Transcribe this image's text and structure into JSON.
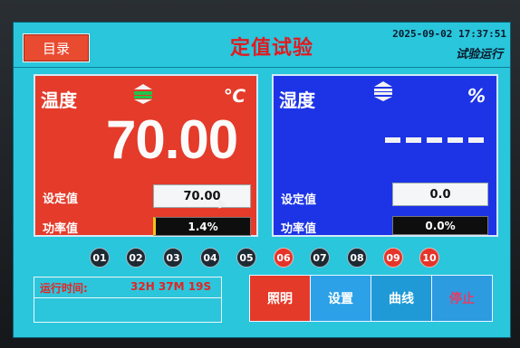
{
  "header": {
    "menu_label": "目录",
    "title": "定值试验",
    "datetime": "2025-09-02 17:37:51",
    "status": "试验运行"
  },
  "temperature": {
    "label": "温度",
    "unit": "℃",
    "value": "70.00",
    "set_label": "设定值",
    "set_value": "70.00",
    "power_label": "功率值",
    "power_value": "1.4%",
    "arrow_colors": {
      "up": "#f2f2f2",
      "mid": "#22c24b",
      "down": "#f2f2f2"
    }
  },
  "humidity": {
    "label": "湿度",
    "unit": "%",
    "value_placeholder": "-----",
    "set_label": "设定值",
    "set_value": "0.0",
    "power_label": "功率值",
    "power_value": "0.0%"
  },
  "channels": [
    {
      "label": "01",
      "state": "off"
    },
    {
      "label": "02",
      "state": "off"
    },
    {
      "label": "03",
      "state": "off"
    },
    {
      "label": "04",
      "state": "off"
    },
    {
      "label": "05",
      "state": "off"
    },
    {
      "label": "06",
      "state": "on"
    },
    {
      "label": "07",
      "state": "off"
    },
    {
      "label": "08",
      "state": "off"
    },
    {
      "label": "09",
      "state": "on"
    },
    {
      "label": "10",
      "state": "on"
    }
  ],
  "runtime": {
    "label": "运行时间:",
    "value": "32H 37M 19S"
  },
  "buttons": [
    {
      "label": "照明"
    },
    {
      "label": "设置"
    },
    {
      "label": "曲线"
    },
    {
      "label": "停止"
    }
  ],
  "colors": {
    "screen_bg": "#29c6dc",
    "temp_panel": "#e43b2a",
    "hum_panel": "#1d34e6",
    "alarm_red": "#e53429"
  }
}
